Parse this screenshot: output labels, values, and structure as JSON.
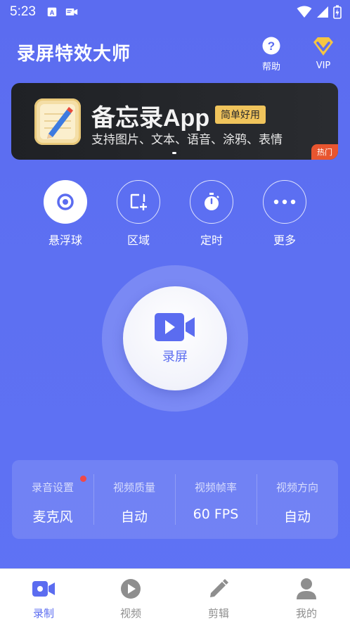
{
  "status_bar": {
    "time": "5:23"
  },
  "header": {
    "title": "录屏特效大师",
    "help_label": "帮助",
    "vip_label": "VIP"
  },
  "banner": {
    "title": "备忘录App",
    "tag": "简单好用",
    "subtitle": "支持图片、文本、语音、涂鸦、表情",
    "hot_badge": "热门"
  },
  "tools": [
    {
      "label": "悬浮球",
      "icon": "floating-ball-icon"
    },
    {
      "label": "区域",
      "icon": "region-add-icon"
    },
    {
      "label": "定时",
      "icon": "timer-icon"
    },
    {
      "label": "更多",
      "icon": "more-dots-icon"
    }
  ],
  "record": {
    "label": "录屏",
    "icon": "video-camera-icon"
  },
  "settings": [
    {
      "key": "录音设置",
      "value": "麦克风"
    },
    {
      "key": "视频质量",
      "value": "自动"
    },
    {
      "key": "视频帧率",
      "value": "60 FPS"
    },
    {
      "key": "视频方向",
      "value": "自动"
    }
  ],
  "nav": [
    {
      "label": "录制",
      "icon": "record-tab-icon",
      "active": true
    },
    {
      "label": "视频",
      "icon": "play-tab-icon"
    },
    {
      "label": "剪辑",
      "icon": "pencil-tab-icon"
    },
    {
      "label": "我的",
      "icon": "person-tab-icon"
    }
  ],
  "colors": {
    "accent": "#5b6cf0",
    "banner_bg": "#1f2125",
    "banner_tag": "#f0c45c",
    "hot_badge": "#e8552f",
    "vip_gold": "#f5c542",
    "notice_red": "#f04848"
  }
}
